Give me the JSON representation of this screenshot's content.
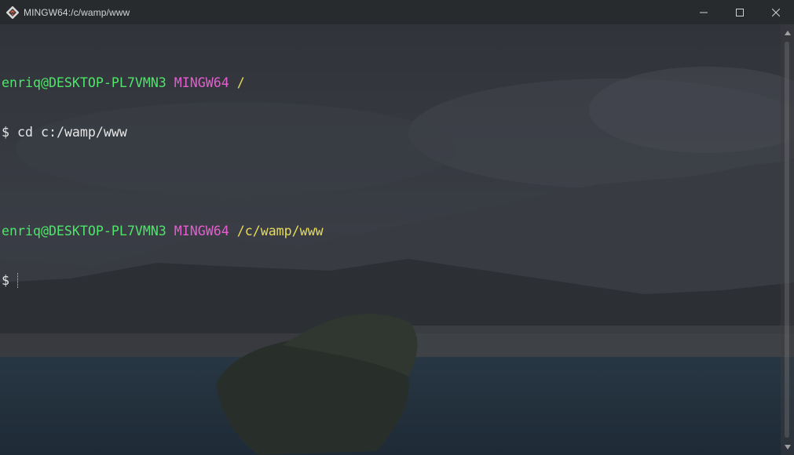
{
  "window": {
    "title": "MINGW64:/c/wamp/www",
    "app_icon": "git-bash-icon",
    "controls": [
      "minimize-icon",
      "maximize-icon",
      "close-icon"
    ]
  },
  "terminal": {
    "lines": [
      {
        "user_host": "enriq@DESKTOP-PL7VMN3",
        "system": "MINGW64",
        "path": "/"
      },
      {
        "prompt": "$",
        "command": "cd c:/wamp/www"
      },
      {
        "user_host": "enriq@DESKTOP-PL7VMN3",
        "system": "MINGW64",
        "path": "/c/wamp/www"
      },
      {
        "prompt": "$",
        "command": ""
      }
    ]
  },
  "colors": {
    "user_host": "#4ee56a",
    "system": "#e45ed0",
    "path": "#e8dc5a",
    "text": "#e6e6e6"
  }
}
